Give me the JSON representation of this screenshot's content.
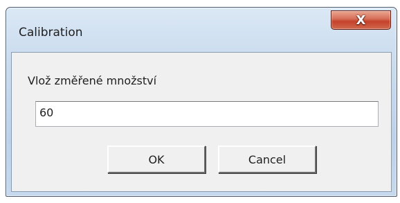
{
  "window": {
    "title": "Calibration",
    "close_icon": "close-icon",
    "close_glyph": "X"
  },
  "dialog": {
    "prompt": "Vlož změřené množství",
    "input_value": "60"
  },
  "buttons": {
    "ok_label": "OK",
    "cancel_label": "Cancel"
  },
  "colors": {
    "titlebar_glass": "#c9dbee",
    "close_button": "#c4412a",
    "client_background": "#f0f0f0"
  }
}
